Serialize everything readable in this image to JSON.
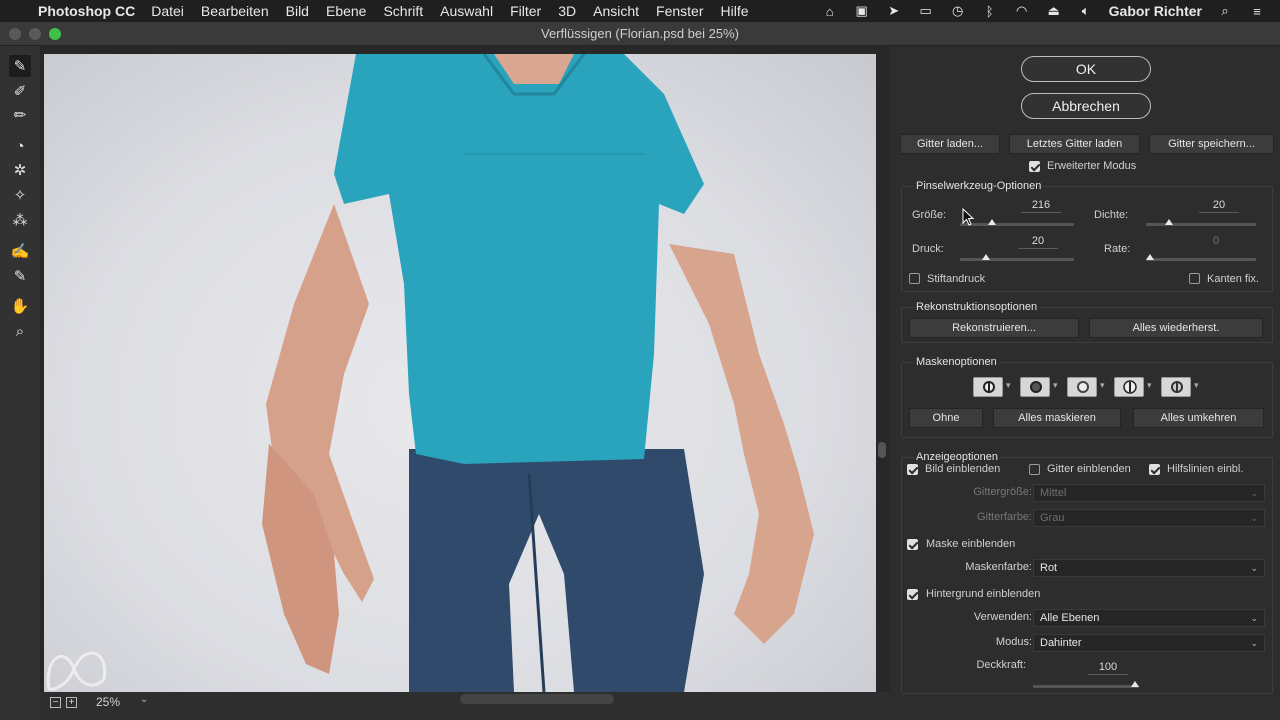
{
  "menubar": {
    "app_name": "Photoshop CC",
    "items": [
      "Datei",
      "Bearbeiten",
      "Bild",
      "Ebene",
      "Schrift",
      "Auswahl",
      "Filter",
      "3D",
      "Ansicht",
      "Fenster",
      "Hilfe"
    ],
    "user": "Gabor Richter"
  },
  "window": {
    "title": "Verflüssigen (Florian.psd bei 25%)"
  },
  "canvas": {
    "zoom": "25%"
  },
  "dialog": {
    "ok_label": "OK",
    "cancel_label": "Abbrechen",
    "load_mesh_label": "Gitter laden...",
    "load_last_mesh_label": "Letztes Gitter laden",
    "save_mesh_label": "Gitter speichern...",
    "advanced_mode_label": "Erweiterter Modus",
    "advanced_mode_checked": true
  },
  "brush_options": {
    "title": "Pinselwerkzeug-Optionen",
    "size_label": "Größe:",
    "size_value": "216",
    "density_label": "Dichte:",
    "density_value": "20",
    "pressure_label": "Druck:",
    "pressure_value": "20",
    "rate_label": "Rate:",
    "rate_value": "0",
    "stylus_label": "Stiftandruck",
    "pin_edges_label": "Kanten fix."
  },
  "reconstruct_options": {
    "title": "Rekonstruktionsoptionen",
    "reconstruct_label": "Rekonstruieren...",
    "restore_all_label": "Alles wiederherst."
  },
  "mask_options": {
    "title": "Maskenoptionen",
    "none_label": "Ohne",
    "mask_all_label": "Alles maskieren",
    "invert_all_label": "Alles umkehren"
  },
  "view_options": {
    "title": "Anzeigeoptionen",
    "show_image_label": "Bild einblenden",
    "show_image_checked": true,
    "show_mesh_label": "Gitter einblenden",
    "show_mesh_checked": false,
    "show_guides_label": "Hilfslinien einbl.",
    "show_guides_checked": true,
    "mesh_size_label": "Gittergröße:",
    "mesh_size_value": "Mittel",
    "mesh_color_label": "Gitterfarbe:",
    "mesh_color_value": "Grau",
    "show_mask_label": "Maske einblenden",
    "show_mask_checked": true,
    "mask_color_label": "Maskenfarbe:",
    "mask_color_value": "Rot",
    "show_backdrop_label": "Hintergrund einblenden",
    "show_backdrop_checked": true,
    "use_label": "Verwenden:",
    "use_value": "Alle Ebenen",
    "mode_label": "Modus:",
    "mode_value": "Dahinter",
    "opacity_label": "Deckkraft:",
    "opacity_value": "100"
  }
}
